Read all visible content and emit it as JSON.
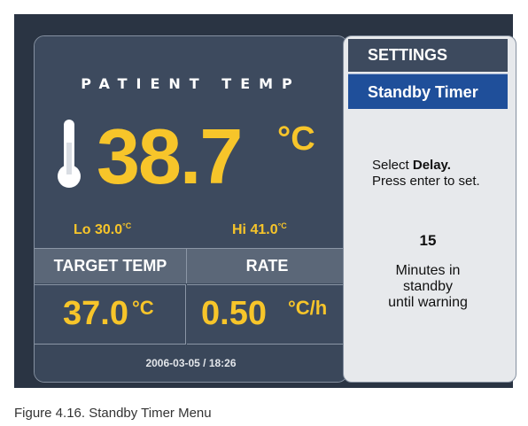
{
  "patient_temp": {
    "title": "PATIENT TEMP",
    "value": "38.7",
    "unit": "°C",
    "lo_label": "Lo",
    "lo_value": "30.0",
    "lo_unit": "°C",
    "hi_label": "Hi",
    "hi_value": "41.0",
    "hi_unit": "°C"
  },
  "target_temp": {
    "label": "TARGET TEMP",
    "value": "37.0",
    "unit": "°C"
  },
  "rate": {
    "label": "RATE",
    "value": "0.50",
    "unit": "°C/h"
  },
  "datetime": "2006-03-05 / 18:26",
  "menu": {
    "settings": "SETTINGS",
    "selected": "Standby Timer"
  },
  "instructions": {
    "select_prefix": "Select ",
    "select_bold": "Delay.",
    "press": "Press enter to set."
  },
  "standby": {
    "minutes": "15",
    "line1": "Minutes in",
    "line2": "standby",
    "line3": "until warning"
  },
  "caption": "Figure 4.16. Standby Timer Menu",
  "colors": {
    "value_yellow": "#f7c52a",
    "panel": "#3d4a5e",
    "highlight": "#1f4f9a"
  },
  "icons": [
    "thermometer-icon"
  ]
}
